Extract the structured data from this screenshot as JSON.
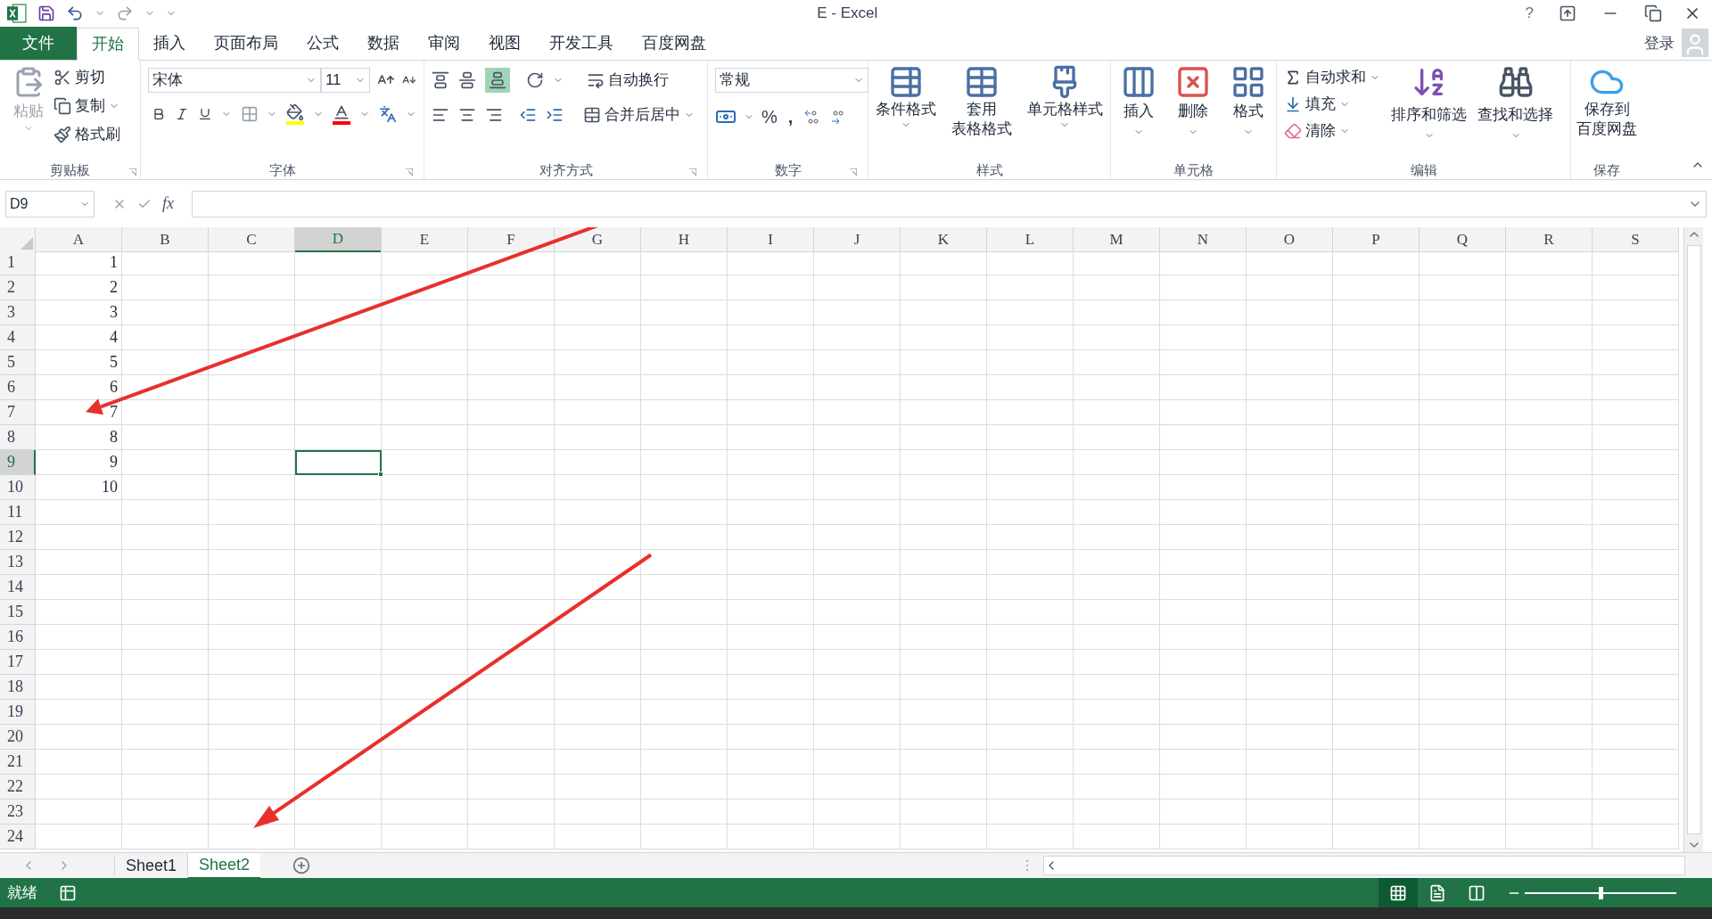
{
  "window": {
    "title": "E - Excel",
    "help": "?"
  },
  "account": {
    "sign_in": "登录"
  },
  "ribbon_tabs": [
    {
      "label": "文件",
      "kind": "file",
      "selected": false
    },
    {
      "label": "开始",
      "kind": "tab",
      "selected": true
    },
    {
      "label": "插入",
      "kind": "tab",
      "selected": false
    },
    {
      "label": "页面布局",
      "kind": "tab",
      "selected": false
    },
    {
      "label": "公式",
      "kind": "tab",
      "selected": false
    },
    {
      "label": "数据",
      "kind": "tab",
      "selected": false
    },
    {
      "label": "审阅",
      "kind": "tab",
      "selected": false
    },
    {
      "label": "视图",
      "kind": "tab",
      "selected": false
    },
    {
      "label": "开发工具",
      "kind": "tab",
      "selected": false
    },
    {
      "label": "百度网盘",
      "kind": "tab",
      "selected": false
    }
  ],
  "clipboard": {
    "label": "剪贴板",
    "paste": "粘贴",
    "items": [
      "剪切",
      "复制",
      "格式刷"
    ]
  },
  "font": {
    "label": "字体",
    "font_name": "宋体",
    "font_size": "11"
  },
  "alignment": {
    "label": "对齐方式",
    "wrap_text": "自动换行",
    "merge_center": "合并后居中",
    "bottom_align_on": true
  },
  "number": {
    "label": "数字",
    "format": "常规",
    "percent": "%",
    "comma": ","
  },
  "styles": {
    "label": "样式",
    "items": [
      [
        "条件格式"
      ],
      [
        "套用",
        "表格格式"
      ],
      [
        "单元格样式"
      ]
    ]
  },
  "cells": {
    "label": "单元格",
    "items": [
      "插入",
      "删除",
      "格式"
    ]
  },
  "editing": {
    "label": "编辑",
    "small_items": [
      "自动求和",
      "填充",
      "清除"
    ],
    "large_items": [
      "排序和筛选",
      "查找和选择"
    ]
  },
  "save": {
    "label": "保存",
    "button_lines": [
      "保存到",
      "百度网盘"
    ]
  },
  "formula_bar": {
    "name_box": "D9",
    "function_button": "fx"
  },
  "columns": [
    {
      "label": "A",
      "selected": false
    },
    {
      "label": "B",
      "selected": false
    },
    {
      "label": "C",
      "selected": false
    },
    {
      "label": "D",
      "selected": true
    },
    {
      "label": "E",
      "selected": false
    },
    {
      "label": "F",
      "selected": false
    },
    {
      "label": "G",
      "selected": false
    },
    {
      "label": "H",
      "selected": false
    },
    {
      "label": "I",
      "selected": false
    },
    {
      "label": "J",
      "selected": false
    },
    {
      "label": "K",
      "selected": false
    },
    {
      "label": "L",
      "selected": false
    },
    {
      "label": "M",
      "selected": false
    },
    {
      "label": "N",
      "selected": false
    },
    {
      "label": "O",
      "selected": false
    },
    {
      "label": "P",
      "selected": false
    },
    {
      "label": "Q",
      "selected": false
    },
    {
      "label": "R",
      "selected": false
    },
    {
      "label": "S",
      "selected": false
    }
  ],
  "rows": [
    {
      "header": "1",
      "selected": false,
      "value": "1"
    },
    {
      "header": "2",
      "selected": false,
      "value": "2"
    },
    {
      "header": "3",
      "selected": false,
      "value": "3"
    },
    {
      "header": "4",
      "selected": false,
      "value": "4"
    },
    {
      "header": "5",
      "selected": false,
      "value": "5"
    },
    {
      "header": "6",
      "selected": false,
      "value": "6"
    },
    {
      "header": "7",
      "selected": false,
      "value": "7"
    },
    {
      "header": "8",
      "selected": false,
      "value": "8"
    },
    {
      "header": "9",
      "selected": true,
      "value": "9"
    },
    {
      "header": "10",
      "selected": false,
      "value": "10"
    },
    {
      "header": "11",
      "selected": false
    },
    {
      "header": "12",
      "selected": false
    },
    {
      "header": "13",
      "selected": false
    },
    {
      "header": "14",
      "selected": false
    },
    {
      "header": "15",
      "selected": false
    },
    {
      "header": "16",
      "selected": false
    },
    {
      "header": "17",
      "selected": false
    },
    {
      "header": "18",
      "selected": false
    },
    {
      "header": "19",
      "selected": false
    },
    {
      "header": "20",
      "selected": false
    },
    {
      "header": "21",
      "selected": false
    },
    {
      "header": "22",
      "selected": false
    },
    {
      "header": "23",
      "selected": false
    },
    {
      "header": "24",
      "selected": false
    }
  ],
  "sheets": [
    {
      "label": "Sheet1",
      "selected": false
    },
    {
      "label": "Sheet2",
      "selected": true
    }
  ],
  "status_bar": {
    "status": "就绪",
    "zoom": {
      "level": 0.5
    }
  }
}
